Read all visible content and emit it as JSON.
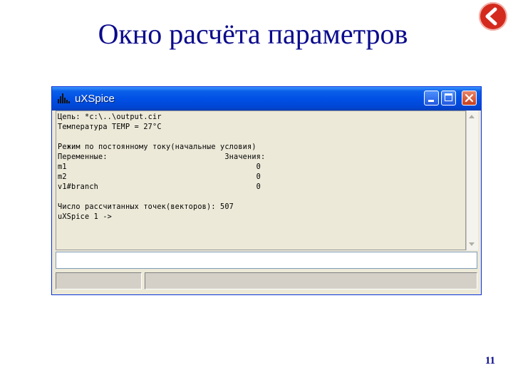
{
  "slide": {
    "title": "Окно расчёта параметров",
    "page_number": "11"
  },
  "window": {
    "title": "uXSpice",
    "console_lines": [
      "Цепь: *c:\\..\\output.cir",
      "Температура TEMP = 27°C",
      "",
      "Режим по постоянному току(начальные условия)",
      "Переменные:                          Значения:",
      "m1                                          0",
      "m2                                          0",
      "v1#branch                                   0",
      "",
      "Число рассчитанных точек(векторов): 507",
      "uXSpice 1 ->"
    ],
    "input_value": "",
    "status": [
      "",
      ""
    ]
  },
  "colors": {
    "title_text": "#0a0a8c",
    "titlebar": "#0050e6",
    "back_button": "#d42a1e"
  },
  "icons": [
    "back-arrow-icon",
    "app-histogram-icon",
    "minimize-icon",
    "maximize-icon",
    "close-icon",
    "scroll-up-icon",
    "scroll-down-icon"
  ]
}
